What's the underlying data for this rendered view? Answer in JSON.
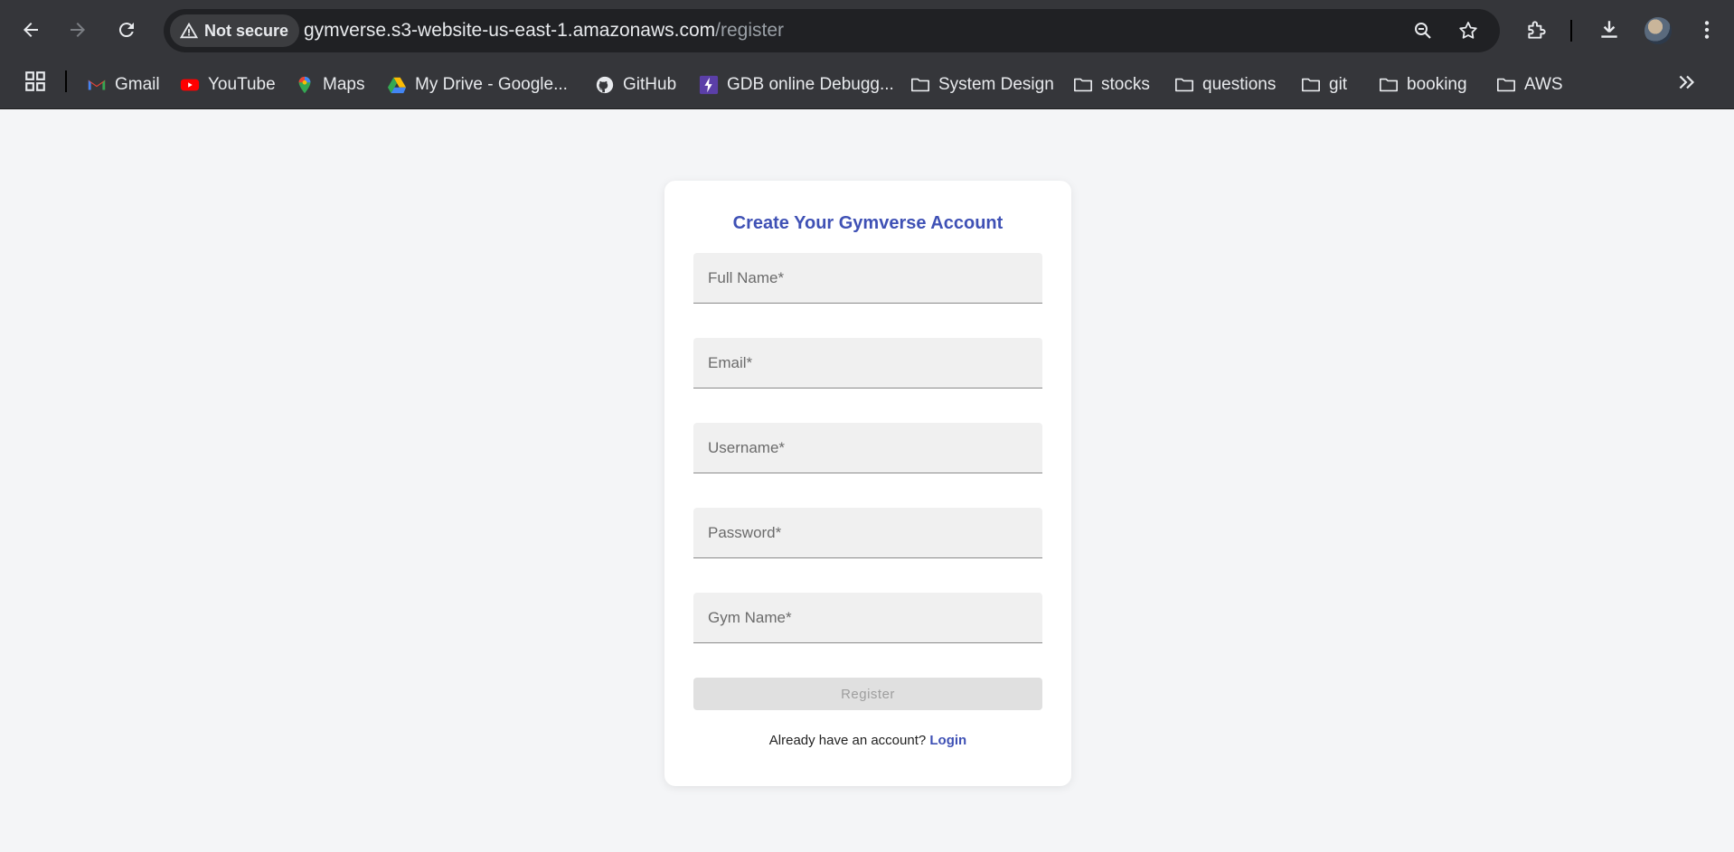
{
  "browser": {
    "security_label": "Not secure",
    "url_host": "gymverse.s3-website-us-east-1.amazonaws.com",
    "url_path": "/register",
    "icons": [
      "back-icon",
      "forward-icon",
      "reload-icon",
      "warning-icon",
      "zoom-icon",
      "star-icon",
      "extensions-icon",
      "download-icon",
      "menu-icon"
    ]
  },
  "bookmarks": {
    "items": [
      {
        "label": "Gmail",
        "icon": "gmail-icon"
      },
      {
        "label": "YouTube",
        "icon": "youtube-icon"
      },
      {
        "label": "Maps",
        "icon": "maps-icon"
      },
      {
        "label": "My Drive - Google...",
        "icon": "drive-icon"
      },
      {
        "label": "GitHub",
        "icon": "github-icon"
      },
      {
        "label": "GDB online Debugg...",
        "icon": "gdb-icon"
      },
      {
        "label": "System Design",
        "icon": "folder-icon"
      },
      {
        "label": "stocks",
        "icon": "folder-icon"
      },
      {
        "label": "questions",
        "icon": "folder-icon"
      },
      {
        "label": "git",
        "icon": "folder-icon"
      },
      {
        "label": "booking",
        "icon": "folder-icon"
      },
      {
        "label": "AWS",
        "icon": "folder-icon"
      }
    ]
  },
  "form": {
    "title": "Create Your Gymverse Account",
    "fields": {
      "full_name": {
        "placeholder": "Full Name*",
        "value": ""
      },
      "email": {
        "placeholder": "Email*",
        "value": ""
      },
      "username": {
        "placeholder": "Username*",
        "value": ""
      },
      "password": {
        "placeholder": "Password*",
        "value": ""
      },
      "gym_name": {
        "placeholder": "Gym Name*",
        "value": ""
      }
    },
    "register_label": "Register",
    "login_prompt": "Already have an account?",
    "login_link": "Login"
  },
  "colors": {
    "accent": "#3f51b5",
    "page_bg": "#f4f5f7",
    "chrome_bg": "#35363a"
  }
}
